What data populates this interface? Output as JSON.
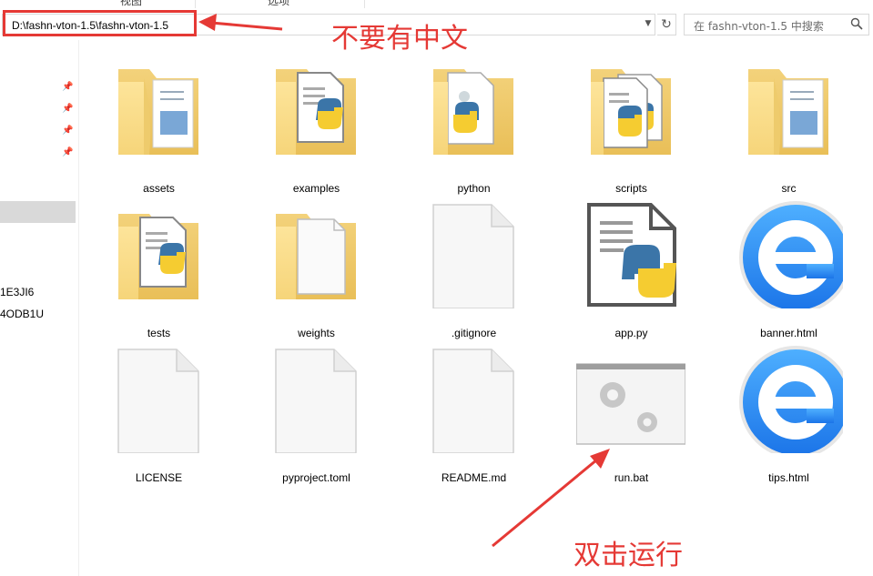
{
  "ribbon": {
    "tabs": [
      "视图",
      "选项"
    ]
  },
  "address_bar": {
    "path": "D:\\fashn-vton-1.5\\fashn-vton-1.5"
  },
  "search": {
    "placeholder": "在 fashn-vton-1.5 中搜索"
  },
  "nav_pane": {
    "items": [
      "1E3JI6",
      "4ODB1U"
    ]
  },
  "files": [
    {
      "name": "assets",
      "icon": "folder-icon"
    },
    {
      "name": "examples",
      "icon": "folder-python-icon"
    },
    {
      "name": "python",
      "icon": "folder-python-icon"
    },
    {
      "name": "scripts",
      "icon": "folder-python-icon"
    },
    {
      "name": "src",
      "icon": "folder-icon"
    },
    {
      "name": "tests",
      "icon": "folder-python-icon"
    },
    {
      "name": "weights",
      "icon": "folder-blank-icon"
    },
    {
      "name": ".gitignore",
      "icon": "blank-file-icon"
    },
    {
      "name": "app.py",
      "icon": "python-file-icon"
    },
    {
      "name": "banner.html",
      "icon": "browser-e-icon"
    },
    {
      "name": "LICENSE",
      "icon": "blank-file-icon"
    },
    {
      "name": "pyproject.toml",
      "icon": "blank-file-icon"
    },
    {
      "name": "README.md",
      "icon": "blank-file-icon"
    },
    {
      "name": "run.bat",
      "icon": "batch-file-icon"
    },
    {
      "name": "tips.html",
      "icon": "browser-e-icon"
    }
  ],
  "annotations": {
    "no_chinese": "不要有中文",
    "double_click_run": "双击运行",
    "color": "#e53935"
  }
}
